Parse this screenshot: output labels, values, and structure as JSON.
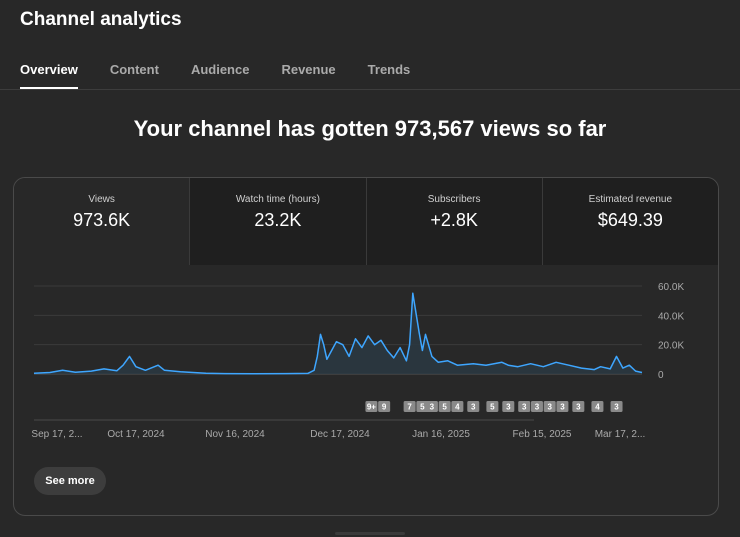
{
  "header": {
    "title": "Channel analytics"
  },
  "tabs": [
    {
      "label": "Overview",
      "active": true
    },
    {
      "label": "Content",
      "active": false
    },
    {
      "label": "Audience",
      "active": false
    },
    {
      "label": "Revenue",
      "active": false
    },
    {
      "label": "Trends",
      "active": false
    }
  ],
  "headline": "Your channel has gotten 973,567 views so far",
  "metrics": [
    {
      "label": "Views",
      "value": "973.6K"
    },
    {
      "label": "Watch time (hours)",
      "value": "23.2K"
    },
    {
      "label": "Subscribers",
      "value": "+2.8K"
    },
    {
      "label": "Estimated revenue",
      "value": "$649.39"
    }
  ],
  "see_more_label": "See more",
  "colors": {
    "line": "#3ea6ff",
    "fill": "#2b3944",
    "grid": "#3a3a3a",
    "axis_text": "#aaaaaa",
    "marker_bg": "#8a8a8a"
  },
  "chart_data": {
    "type": "area",
    "x_tick_labels": [
      "Sep 17, 2...",
      "Oct 17, 2024",
      "Nov 16, 2024",
      "Dec 17, 2024",
      "Jan 16, 2025",
      "Feb 15, 2025",
      "Mar 17, 2..."
    ],
    "y_tick_labels": [
      "60.0K",
      "40.0K",
      "20.0K",
      "0"
    ],
    "ylim": [
      0,
      60000
    ],
    "x_start": "2024-09-17",
    "x_end": "2025-03-27",
    "points": [
      [
        "2024-09-17",
        500
      ],
      [
        "2024-09-22",
        1000
      ],
      [
        "2024-09-26",
        2500
      ],
      [
        "2024-09-30",
        1200
      ],
      [
        "2024-10-05",
        2000
      ],
      [
        "2024-10-09",
        3500
      ],
      [
        "2024-10-13",
        2200
      ],
      [
        "2024-10-15",
        6000
      ],
      [
        "2024-10-17",
        12000
      ],
      [
        "2024-10-19",
        5000
      ],
      [
        "2024-10-22",
        2500
      ],
      [
        "2024-10-26",
        6000
      ],
      [
        "2024-10-28",
        2500
      ],
      [
        "2024-11-02",
        1500
      ],
      [
        "2024-11-06",
        1000
      ],
      [
        "2024-11-10",
        500
      ],
      [
        "2024-11-16",
        300
      ],
      [
        "2024-11-25",
        200
      ],
      [
        "2024-12-05",
        300
      ],
      [
        "2024-12-12",
        400
      ],
      [
        "2024-12-14",
        2500
      ],
      [
        "2024-12-15",
        12000
      ],
      [
        "2024-12-16",
        27000
      ],
      [
        "2024-12-17",
        20000
      ],
      [
        "2024-12-18",
        10000
      ],
      [
        "2024-12-19",
        14000
      ],
      [
        "2024-12-21",
        22000
      ],
      [
        "2024-12-23",
        20000
      ],
      [
        "2024-12-25",
        12000
      ],
      [
        "2024-12-27",
        24000
      ],
      [
        "2024-12-29",
        18000
      ],
      [
        "2024-12-31",
        26000
      ],
      [
        "2025-01-02",
        20000
      ],
      [
        "2025-01-04",
        23000
      ],
      [
        "2025-01-06",
        16000
      ],
      [
        "2025-01-08",
        11000
      ],
      [
        "2025-01-10",
        18000
      ],
      [
        "2025-01-12",
        9000
      ],
      [
        "2025-01-13",
        20000
      ],
      [
        "2025-01-14",
        55000
      ],
      [
        "2025-01-16",
        28000
      ],
      [
        "2025-01-17",
        16000
      ],
      [
        "2025-01-18",
        27000
      ],
      [
        "2025-01-20",
        12000
      ],
      [
        "2025-01-22",
        8000
      ],
      [
        "2025-01-25",
        9000
      ],
      [
        "2025-01-28",
        6000
      ],
      [
        "2025-02-02",
        7000
      ],
      [
        "2025-02-06",
        6000
      ],
      [
        "2025-02-11",
        8000
      ],
      [
        "2025-02-13",
        6000
      ],
      [
        "2025-02-16",
        5000
      ],
      [
        "2025-02-20",
        7000
      ],
      [
        "2025-02-24",
        5000
      ],
      [
        "2025-02-28",
        8000
      ],
      [
        "2025-03-04",
        6000
      ],
      [
        "2025-03-08",
        4000
      ],
      [
        "2025-03-12",
        3000
      ],
      [
        "2025-03-14",
        5000
      ],
      [
        "2025-03-17",
        3500
      ],
      [
        "2025-03-19",
        12000
      ],
      [
        "2025-03-21",
        4000
      ],
      [
        "2025-03-23",
        6000
      ],
      [
        "2025-03-25",
        2000
      ],
      [
        "2025-03-27",
        1000
      ]
    ],
    "markers": [
      {
        "label": "9+",
        "date": "2025-01-01"
      },
      {
        "label": "9",
        "date": "2025-01-05"
      },
      {
        "label": "7",
        "date": "2025-01-13"
      },
      {
        "label": "5",
        "date": "2025-01-17"
      },
      {
        "label": "3",
        "date": "2025-01-20"
      },
      {
        "label": "5",
        "date": "2025-01-24"
      },
      {
        "label": "4",
        "date": "2025-01-28"
      },
      {
        "label": "3",
        "date": "2025-02-02"
      },
      {
        "label": "5",
        "date": "2025-02-08"
      },
      {
        "label": "3",
        "date": "2025-02-13"
      },
      {
        "label": "3",
        "date": "2025-02-18"
      },
      {
        "label": "3",
        "date": "2025-02-22"
      },
      {
        "label": "3",
        "date": "2025-02-26"
      },
      {
        "label": "3",
        "date": "2025-03-02"
      },
      {
        "label": "3",
        "date": "2025-03-07"
      },
      {
        "label": "4",
        "date": "2025-03-13"
      },
      {
        "label": "3",
        "date": "2025-03-19"
      }
    ]
  }
}
